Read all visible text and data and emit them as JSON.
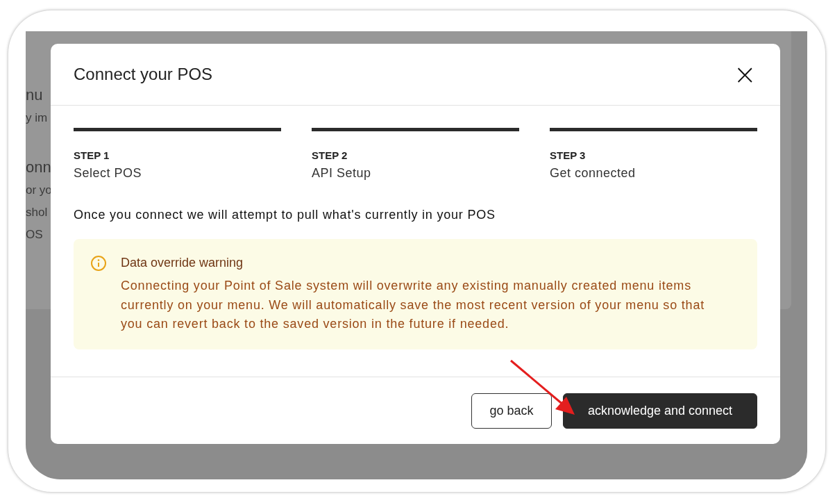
{
  "background_page": {
    "lines": [
      {
        "kind": "heading",
        "text": "nu"
      },
      {
        "kind": "body",
        "text": "y im"
      },
      {
        "kind": "heading",
        "text": "onn"
      },
      {
        "kind": "body",
        "text": "or yo"
      },
      {
        "kind": "body",
        "text": "shol"
      },
      {
        "kind": "body",
        "text": "OS"
      }
    ]
  },
  "modal": {
    "title": "Connect your POS",
    "close": "×",
    "steps": [
      {
        "step": "STEP 1",
        "label": "Select POS"
      },
      {
        "step": "STEP 2",
        "label": "API Setup"
      },
      {
        "step": "STEP 3",
        "label": "Get connected"
      }
    ],
    "intro": "Once you connect we will attempt to pull what's currently in your POS",
    "warning": {
      "title": "Data override warning",
      "body": "Connecting your Point of Sale system will overwrite any existing manually created menu items currently on your menu. We will automatically save the most recent version of your menu so that you can revert back to the saved version in the future if needed."
    },
    "buttons": [
      {
        "kind": "secondary",
        "label": "go back"
      },
      {
        "kind": "primary",
        "label": "acknowledge and connect"
      }
    ]
  }
}
